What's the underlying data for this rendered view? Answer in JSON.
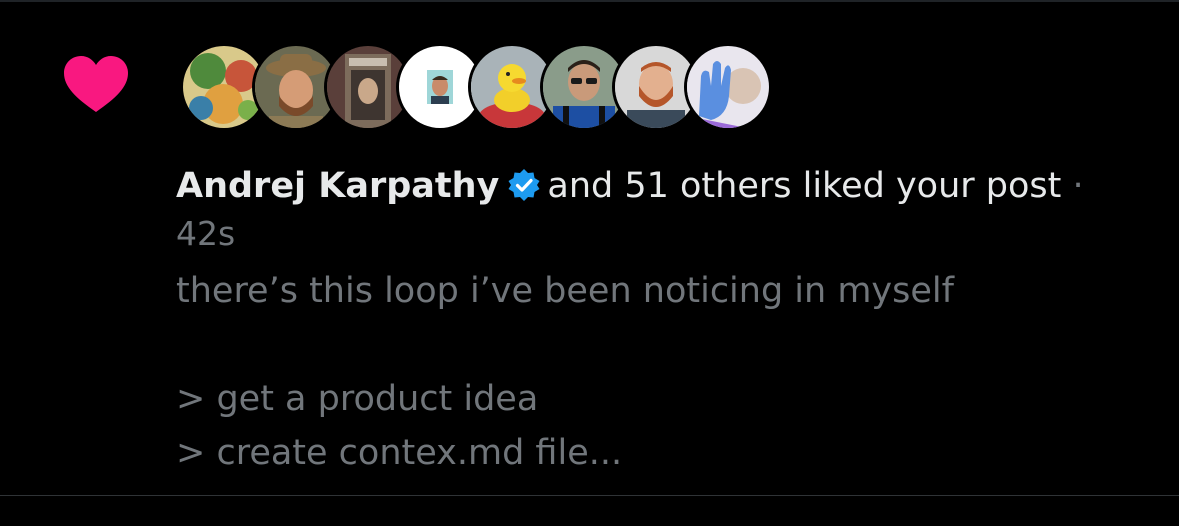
{
  "notification": {
    "icon": "heart-icon",
    "icon_color": "#f91880",
    "liker_name": "Andrej Karpathy",
    "verified_icon": "verified-badge-icon",
    "verified_color": "#1d9bf0",
    "action_text": "and 51 others liked your post",
    "separator": "·",
    "timestamp": "42s",
    "post_lines": [
      "there’s this loop i’ve been noticing in myself",
      "",
      "> get a product idea",
      "> create contex.md file..."
    ],
    "avatars": [
      "illustration-avatar",
      "man-with-hat-avatar",
      "telephone-booth-avatar",
      "cartoon-man-avatar",
      "yellow-duck-avatar",
      "man-with-sunglasses-avatar",
      "red-beard-man-avatar",
      "raised-hand-avatar"
    ]
  }
}
